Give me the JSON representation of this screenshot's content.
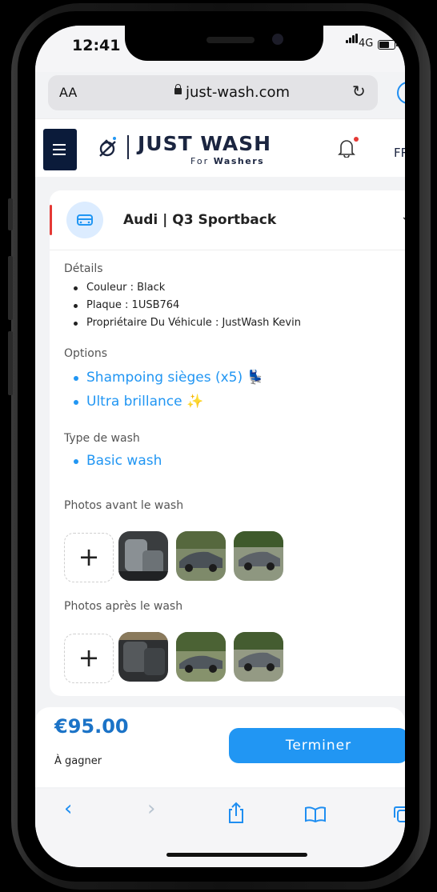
{
  "status_bar": {
    "time": "12:41",
    "network": "4G"
  },
  "browser": {
    "aa_label": "AA",
    "url": "just-wash.com"
  },
  "header": {
    "brand": "JUST WASH",
    "tagline_prefix": "For",
    "tagline_word": "Washers",
    "language": "FR"
  },
  "vehicle": {
    "title": "Audi | Q3 Sportback"
  },
  "details": {
    "heading": "Détails",
    "items": [
      "Couleur : Black",
      "Plaque : 1USB764",
      "Propriétaire Du Véhicule : JustWash Kevin"
    ]
  },
  "options": {
    "heading": "Options",
    "items": [
      "Shampoing sièges (x5) 💺",
      "Ultra brillance ✨"
    ]
  },
  "wash_type": {
    "heading": "Type de wash",
    "value": "Basic wash"
  },
  "photos_before": {
    "heading": "Photos avant le wash",
    "add_label": "+"
  },
  "photos_after": {
    "heading": "Photos après le wash",
    "add_label": "+"
  },
  "footer": {
    "price": "€95.00",
    "price_caption": "À gagner",
    "action": "Terminer"
  },
  "colors": {
    "accent_blue": "#2196f3",
    "navy": "#0b1b3a",
    "alert_red": "#e53935",
    "price_blue": "#1b73c7"
  },
  "icons": [
    "menu-icon",
    "logo-icon",
    "bell-icon",
    "car-icon",
    "chevron-down-icon",
    "lock-icon",
    "reload-icon",
    "download-icon",
    "back-icon",
    "forward-icon",
    "share-icon",
    "bookmarks-icon",
    "tabs-icon"
  ]
}
